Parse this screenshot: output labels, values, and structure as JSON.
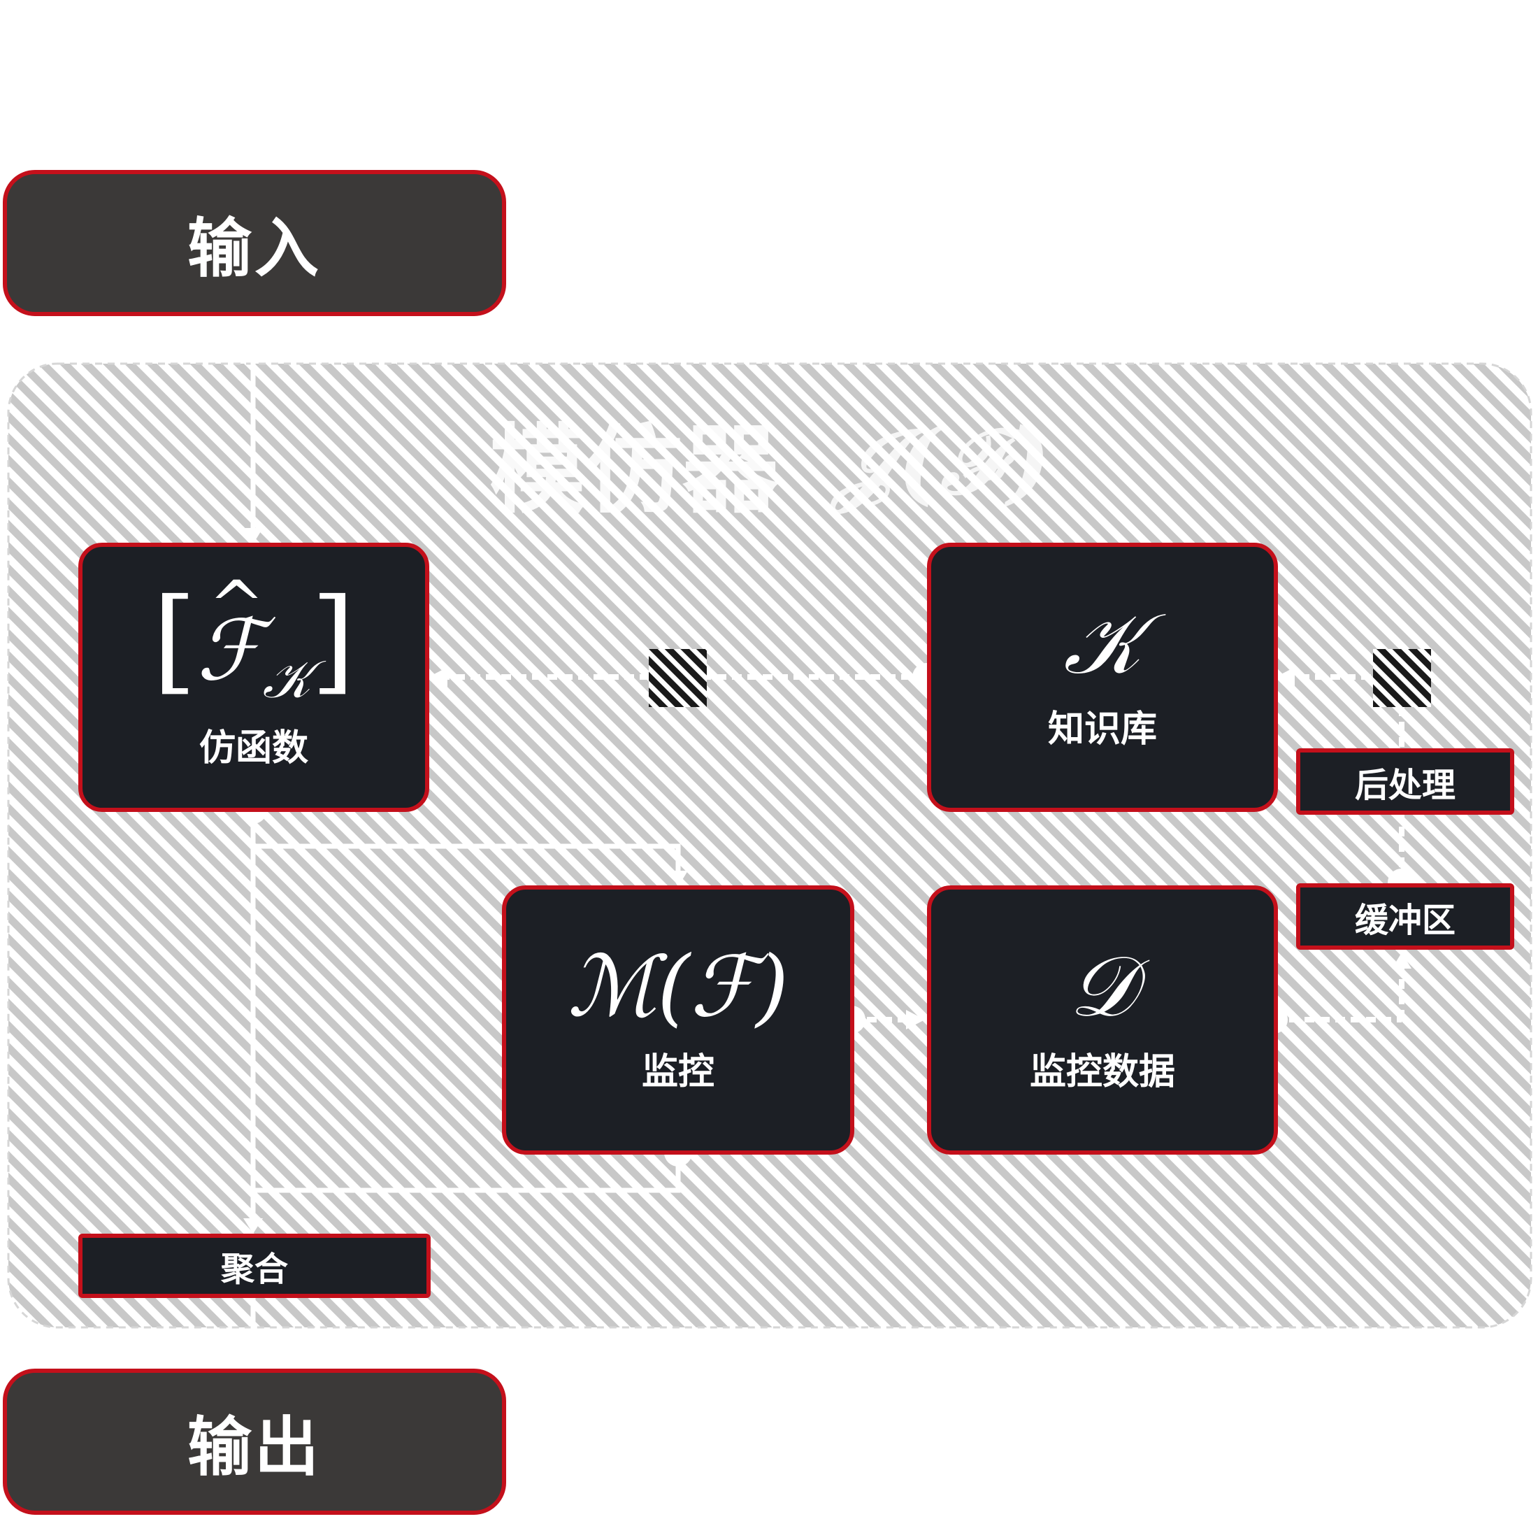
{
  "diagram": {
    "title": "模仿器",
    "title_symbol": "𝒥(ℱ)",
    "nodes": {
      "input": {
        "label": "输入"
      },
      "output": {
        "label": "输出"
      },
      "imitation_function": {
        "label": "仿函数",
        "sym_main": "ℱ",
        "sym_sub": "𝒦"
      },
      "knowledge_base": {
        "label": "知识库",
        "symbol": "𝒦"
      },
      "monitor": {
        "label": "监控",
        "symbol": "ℳ(ℱ)"
      },
      "monitor_data": {
        "label": "监控数据",
        "symbol": "𝒟"
      },
      "postprocess": {
        "label": "后处理"
      },
      "buffer": {
        "label": "缓冲区"
      },
      "aggregate": {
        "label": "聚合"
      }
    },
    "colors": {
      "box_border": "#c4101b",
      "box_fill": "#1c1f25",
      "io_fill": "#3b3938",
      "region_stripes": "#c8c8c8",
      "connectors": "#ffffff"
    }
  }
}
